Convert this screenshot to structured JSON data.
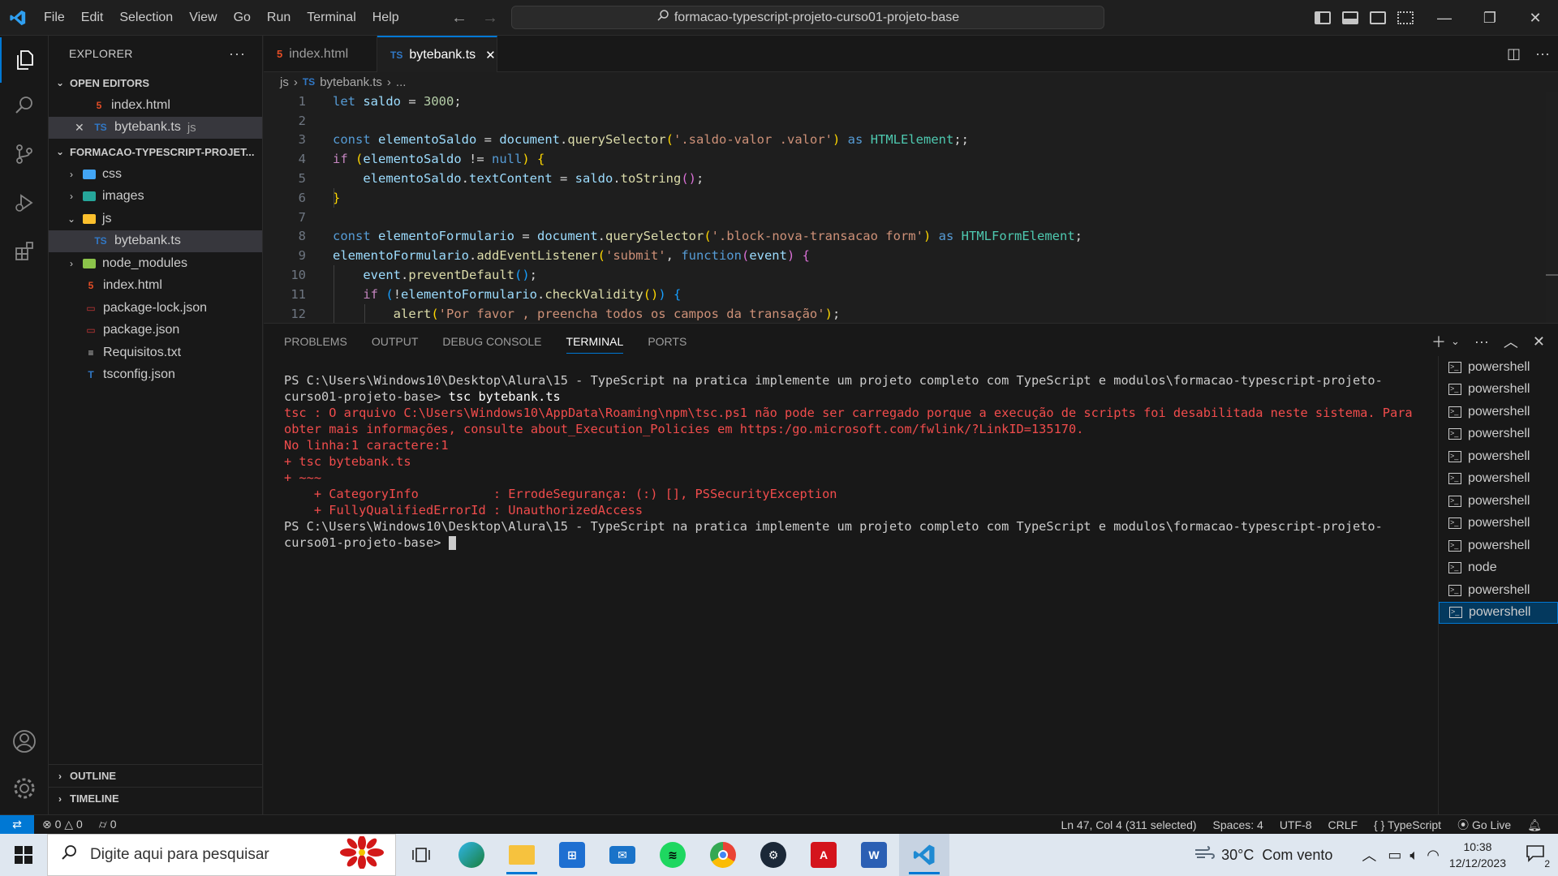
{
  "titlebar": {
    "menu": [
      "File",
      "Edit",
      "Selection",
      "View",
      "Go",
      "Run",
      "Terminal",
      "Help"
    ],
    "search_text": "formacao-typescript-projeto-curso01-projeto-base"
  },
  "sidebar": {
    "title": "EXPLORER",
    "open_editors_label": "OPEN EDITORS",
    "open_editors": [
      {
        "name": "index.html",
        "icon": "html-file-icon"
      },
      {
        "name": "bytebank.ts",
        "desc": "js",
        "icon": "ts-file-icon"
      }
    ],
    "project_label": "FORMACAO-TYPESCRIPT-PROJET...",
    "tree": [
      {
        "name": "css"
      },
      {
        "name": "images"
      },
      {
        "name": "js"
      },
      {
        "name": "bytebank.ts"
      },
      {
        "name": "node_modules"
      },
      {
        "name": "index.html"
      },
      {
        "name": "package-lock.json"
      },
      {
        "name": "package.json"
      },
      {
        "name": "Requisitos.txt"
      },
      {
        "name": "tsconfig.json"
      }
    ],
    "outline_label": "OUTLINE",
    "timeline_label": "TIMELINE"
  },
  "editor": {
    "tabs": [
      {
        "label": "index.html"
      },
      {
        "label": "bytebank.ts"
      }
    ],
    "breadcrumb": [
      "js",
      "bytebank.ts",
      "..."
    ],
    "line_numbers": [
      "1",
      "2",
      "3",
      "4",
      "5",
      "6",
      "7",
      "8",
      "9",
      "10",
      "11",
      "12"
    ]
  },
  "panel": {
    "tabs": [
      "PROBLEMS",
      "OUTPUT",
      "DEBUG CONSOLE",
      "TERMINAL",
      "PORTS"
    ],
    "terminal_lines": {
      "prompt1": "PS C:\\Users\\Windows10\\Desktop\\Alura\\15 - TypeScript na pratica implemente um projeto completo com TypeScript e modulos\\formacao-typescript-projeto-curso01-projeto-base> ",
      "cmd1": "tsc bytebank.ts",
      "err1": "tsc : O arquivo C:\\Users\\Windows10\\AppData\\Roaming\\npm\\tsc.ps1 não pode ser carregado porque a execução de scripts foi desabilitada neste sistema. Para obter mais informações, consulte about_Execution_Policies em https:/go.microsoft.com/fwlink/?LinkID=135170.",
      "err2": "No linha:1 caractere:1",
      "err3": "+ tsc bytebank.ts",
      "err4": "+ ~~~",
      "err5": "    + CategoryInfo          : ErrodeSegurança: (:) [], PSSecurityException",
      "err6": "    + FullyQualifiedErrorId : UnauthorizedAccess",
      "prompt2": "PS C:\\Users\\Windows10\\Desktop\\Alura\\15 - TypeScript na pratica implemente um projeto completo com TypeScript e modulos\\formacao-typescript-projeto-curso01-projeto-base> "
    },
    "terminals": [
      "powershell",
      "powershell",
      "powershell",
      "powershell",
      "powershell",
      "powershell",
      "powershell",
      "powershell",
      "powershell",
      "node",
      "powershell",
      "powershell"
    ]
  },
  "statusbar": {
    "errors": "0",
    "warnings": "0",
    "ports": "0",
    "position": "Ln 47, Col 4 (311 selected)",
    "spaces": "Spaces: 4",
    "encoding": "UTF-8",
    "eol": "CRLF",
    "language": "TypeScript",
    "golive": "Go Live"
  },
  "taskbar": {
    "search_placeholder": "Digite aqui para pesquisar",
    "weather": "30°C  Com vento",
    "time": "10:38",
    "date": "12/12/2023",
    "notifications": "2"
  },
  "colors": {
    "accent": "#0078d4",
    "error_text": "#f14c4c"
  }
}
